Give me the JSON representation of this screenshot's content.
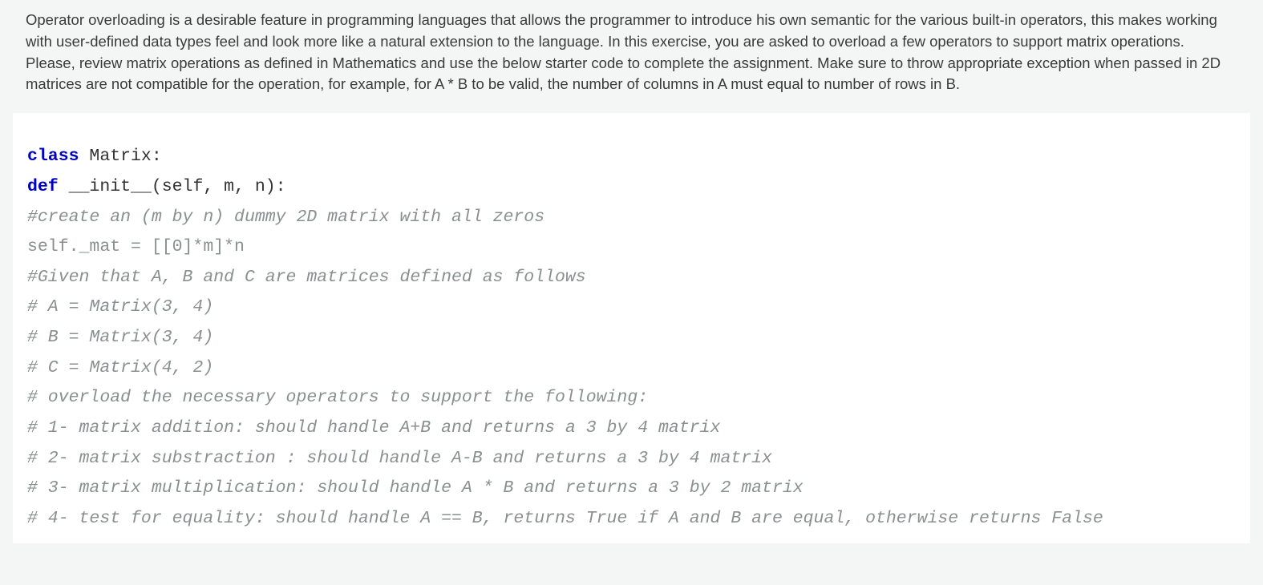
{
  "instructions_text": "Operator overloading is a desirable feature in programming languages that allows the programmer to introduce his own semantic for the various built-in operators, this makes working with user-defined data types feel and look more like a natural extension to the language. In this exercise, you are asked to overload a few operators to support matrix operations. Please, review matrix operations as defined in Mathematics and use the below starter code to complete the assignment. Make sure to throw appropriate exception when passed in 2D matrices are not compatible for the operation, for example, for A * B to be valid, the number of columns in A must equal to number of rows in B.",
  "code": {
    "line01_kw": "class",
    "line01_rest": " Matrix:",
    "line02_kw": "def",
    "line02_rest": " __init__(self, m, n):",
    "line03": "#create an (m by n) dummy 2D matrix with all zeros",
    "line04": "self._mat = [[0]*m]*n",
    "line05": "",
    "line06": "#Given that A, B and C are matrices defined as follows",
    "line07": "# A = Matrix(3, 4)",
    "line08": "# B = Matrix(3, 4)",
    "line09": "# C = Matrix(4, 2)",
    "line10": "# overload the necessary operators to support the following:",
    "line11": "# 1- matrix addition: should handle A+B and returns a 3 by 4 matrix",
    "line12": "# 2- matrix substraction : should handle A-B and returns a 3 by 4 matrix",
    "line13": "# 3- matrix multiplication: should handle A * B and returns a 3 by 2 matrix",
    "line14": "# 4- test for equality: should handle A == B, returns True if A and B are equal, otherwise returns False"
  }
}
